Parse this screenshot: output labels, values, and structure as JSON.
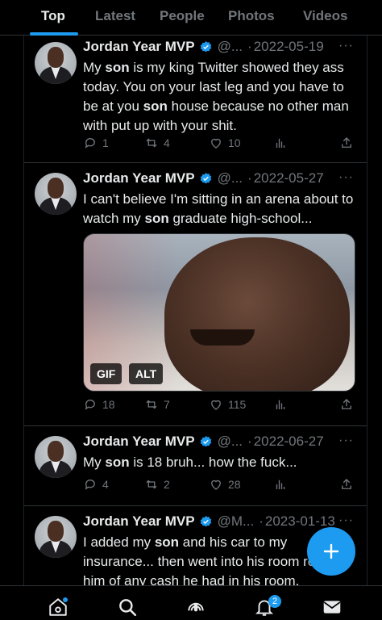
{
  "tabs": [
    {
      "label": "Top",
      "active": true
    },
    {
      "label": "Latest",
      "active": false
    },
    {
      "label": "People",
      "active": false
    },
    {
      "label": "Photos",
      "active": false
    },
    {
      "label": "Videos",
      "active": false
    }
  ],
  "colors": {
    "accent": "#1d9bf0",
    "background": "#000000",
    "text": "#e7e9ea",
    "muted": "#71767b",
    "divider": "#2f3336"
  },
  "tweets": [
    {
      "name": "Jordan Year MVP",
      "handle": "@...",
      "date": "2022-05-19",
      "text_parts": [
        "My ",
        "son",
        " is my king Twitter showed they ass today. You on your last leg and you have to be at you ",
        "son",
        " house because no other man with put up with your shit."
      ],
      "replies": "1",
      "retweets": "4",
      "likes": "10",
      "views": ""
    },
    {
      "name": "Jordan Year MVP",
      "handle": "@...",
      "date": "2022-05-27",
      "text_parts": [
        "I can't believe I'm sitting in an arena about to watch my ",
        "son",
        " graduate high-school..."
      ],
      "media": {
        "type": "gif",
        "gif_label": "GIF",
        "alt_label": "ALT"
      },
      "replies": "18",
      "retweets": "7",
      "likes": "115",
      "views": ""
    },
    {
      "name": "Jordan Year MVP",
      "handle": "@...",
      "date": "2022-06-27",
      "text_parts": [
        "My ",
        "son",
        " is 18 bruh... how the fuck..."
      ],
      "replies": "4",
      "retweets": "2",
      "likes": "28",
      "views": ""
    },
    {
      "name": "Jordan Year MVP",
      "handle": "@M...",
      "date": "2023-01-13",
      "text_parts": [
        "I added my ",
        "son",
        " and his car to my insurance... then went into his room robbed him of any cash he had in his room."
      ]
    }
  ],
  "icons": {
    "more": "more-icon",
    "reply": "reply-icon",
    "retweet": "retweet-icon",
    "like": "heart-icon",
    "views": "views-icon",
    "share": "share-icon",
    "verified": "verified-badge-icon",
    "compose": "plus-icon"
  },
  "more_glyph": "···",
  "bottom_nav": {
    "items": [
      "home-icon",
      "search-icon",
      "spaces-icon",
      "notifications-icon",
      "messages-icon"
    ],
    "notification_count": "2"
  }
}
